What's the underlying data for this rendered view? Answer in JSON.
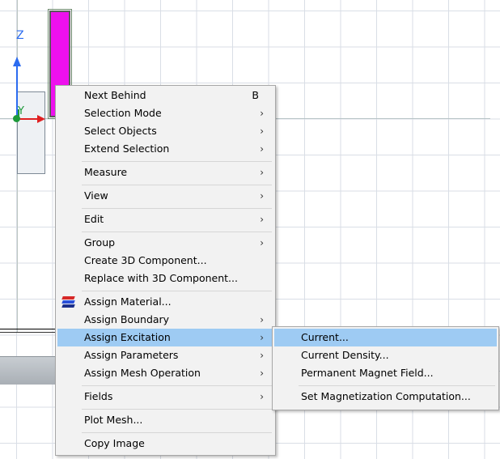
{
  "viewport": {
    "axis_labels": {
      "z": "Z",
      "y": "Y"
    },
    "colors": {
      "coil": "#ee10ee",
      "z_axis": "#2c6cf0",
      "x_axis": "#e02020",
      "y_axis": "#1d9a3a"
    }
  },
  "context_menu": {
    "items": [
      {
        "label": "Next Behind",
        "shortcut": "B"
      },
      {
        "label": "Selection Mode",
        "arrow": "›"
      },
      {
        "label": "Select Objects",
        "arrow": "›"
      },
      {
        "label": "Extend Selection",
        "arrow": "›"
      },
      {
        "label": "Measure",
        "arrow": "›"
      },
      {
        "label": "View",
        "arrow": "›"
      },
      {
        "label": "Edit",
        "arrow": "›"
      },
      {
        "label": "Group",
        "arrow": "›"
      },
      {
        "label": "Create 3D Component..."
      },
      {
        "label": "Replace with 3D Component..."
      },
      {
        "label": "Assign Material...",
        "icon": "material-icon"
      },
      {
        "label": "Assign Boundary",
        "arrow": "›"
      },
      {
        "label": "Assign Excitation",
        "arrow": "›",
        "highlighted": true
      },
      {
        "label": "Assign Parameters",
        "arrow": "›"
      },
      {
        "label": "Assign Mesh Operation",
        "arrow": "›"
      },
      {
        "label": "Fields",
        "arrow": "›"
      },
      {
        "label": "Plot Mesh..."
      },
      {
        "label": "Copy Image"
      }
    ]
  },
  "submenu_excitation": {
    "items": [
      {
        "label": "Current...",
        "highlighted": true
      },
      {
        "label": "Current Density..."
      },
      {
        "label": "Permanent Magnet Field..."
      },
      {
        "label": "Set Magnetization Computation..."
      }
    ]
  },
  "highlight_color": "#9ecbf3"
}
